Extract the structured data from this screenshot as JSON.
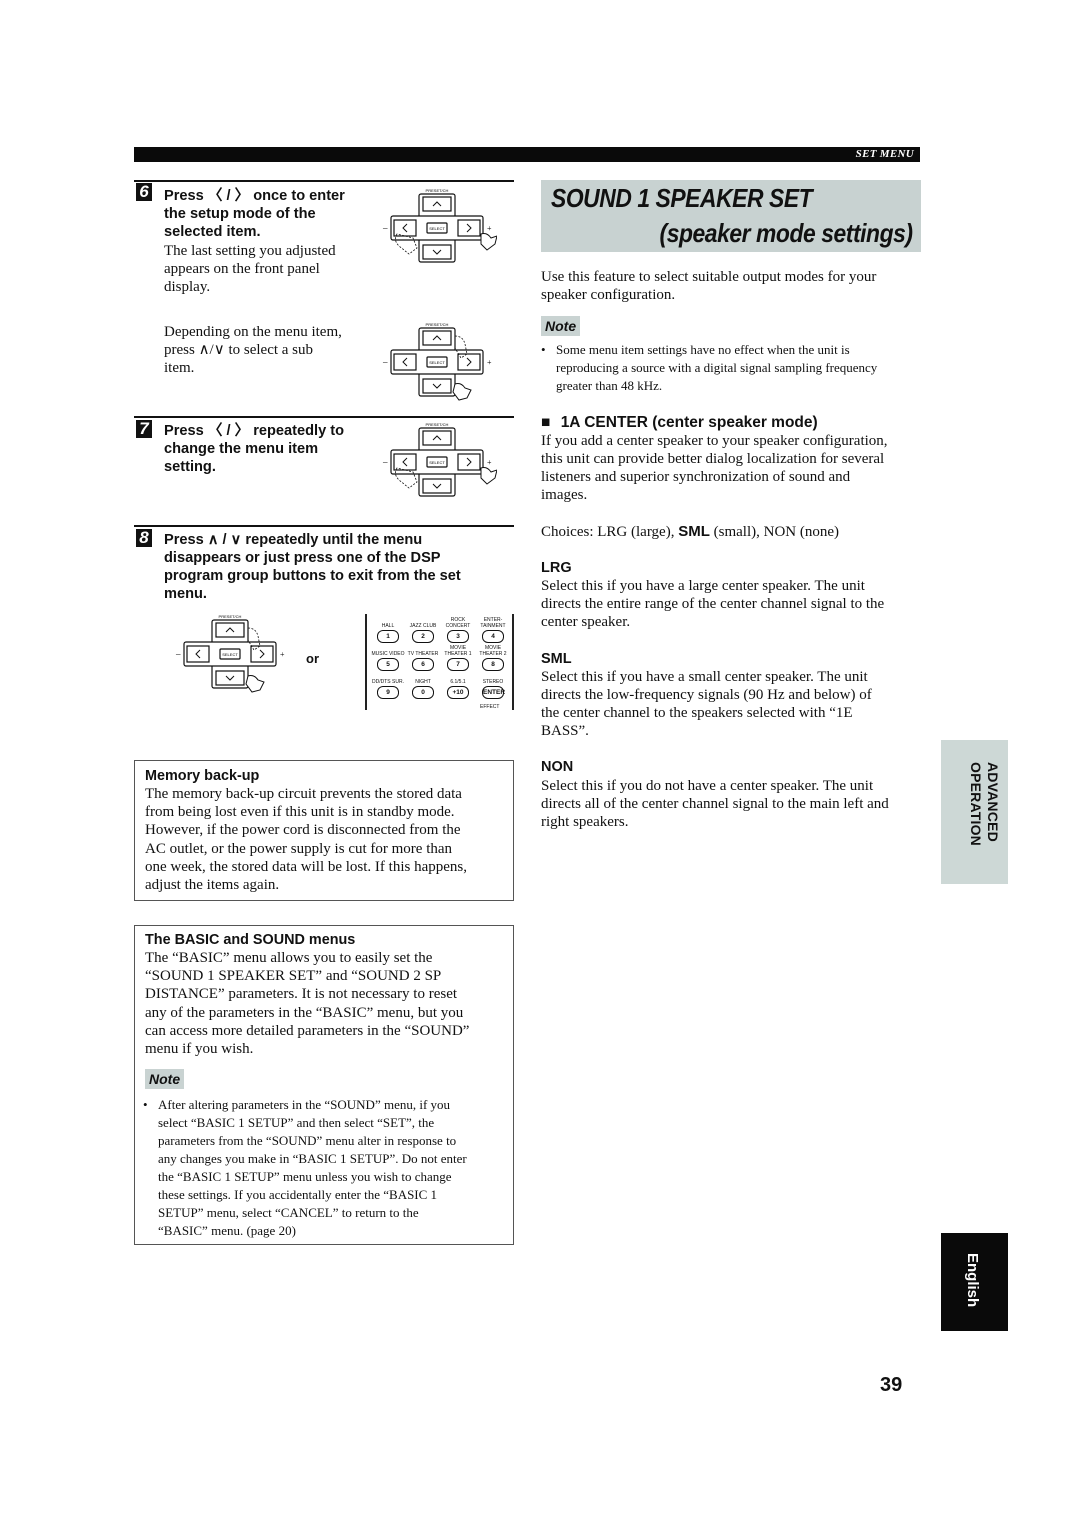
{
  "header": {
    "section_label": "SET MENU"
  },
  "steps": [
    {
      "number": "6",
      "heading": [
        "Press 〈 / 〉 once to enter",
        "the setup mode of the",
        "selected item."
      ],
      "body": [
        "The last setting you adjusted",
        "appears on the front panel",
        "display."
      ],
      "sub_body": [
        "Depending on the menu item,",
        "press ∧/∨ to select a sub",
        "item."
      ]
    },
    {
      "number": "7",
      "heading": [
        "Press 〈 / 〉 repeatedly to",
        "change the menu item",
        "setting."
      ]
    },
    {
      "number": "8",
      "heading": [
        "Press ∧ / ∨ repeatedly until the menu",
        "disappears or just press one of the DSP",
        "program group buttons to exit from the set",
        "menu."
      ]
    }
  ],
  "remote_pad": {
    "top_label": "PRESET/CH",
    "center_label": "SELECT",
    "minus": "–",
    "plus": "+",
    "up": "∧",
    "down": "∨",
    "left": "〈",
    "right": "〉"
  },
  "or_label": "or",
  "dsp_buttons": [
    {
      "label": "HALL",
      "key": "1"
    },
    {
      "label": "JAZZ CLUB",
      "key": "2"
    },
    {
      "label": "ROCK CONCERT",
      "key": "3"
    },
    {
      "label": "ENTER- TAINMENT",
      "key": "4"
    },
    {
      "label": "MUSIC VIDEO",
      "key": "5"
    },
    {
      "label": "TV THEATER",
      "key": "6"
    },
    {
      "label": "MOVIE THEATER 1",
      "key": "7"
    },
    {
      "label": "MOVIE THEATER 2",
      "key": "8"
    },
    {
      "label": "DD/DTS SUR.",
      "key": "9"
    },
    {
      "label": "NIGHT",
      "key": "0"
    },
    {
      "label": "6.1/5.1",
      "key": "+10"
    },
    {
      "label": "STEREO",
      "key": "ENTER"
    }
  ],
  "dsp_effect_label": "EFFECT",
  "memory_box": {
    "title": "Memory back-up",
    "body": [
      "The memory back-up circuit prevents the stored data",
      "from being lost even if this unit is in standby mode.",
      "However, if the power cord is disconnected from the",
      "AC outlet, or the power supply is cut for more than",
      "one week, the stored data will be lost. If this happens,",
      "adjust the items again."
    ]
  },
  "basic_box": {
    "title": "The BASIC and SOUND menus",
    "body": [
      "The “BASIC” menu allows you to easily set the",
      "“SOUND 1 SPEAKER SET” and “SOUND 2 SP",
      "DISTANCE” parameters. It is not necessary to reset",
      "any of the parameters in the “BASIC” menu, but you",
      "can access more detailed parameters in the “SOUND”",
      "menu if you wish."
    ],
    "note_label": "Note",
    "note_bullet": "•",
    "note": [
      "After altering parameters in the “SOUND” menu, if you",
      "select “BASIC 1 SETUP” and then select “SET”, the",
      "parameters from the “SOUND” menu alter in response to",
      "any changes you make in “BASIC 1 SETUP”. Do not enter",
      "the “BASIC 1 SETUP” menu unless you wish to change",
      "these settings. If you accidentally enter the “BASIC 1",
      "SETUP” menu, select “CANCEL” to return to the",
      "“BASIC” menu. (page 20)"
    ]
  },
  "right": {
    "title_line1": "SOUND 1  SPEAKER SET",
    "title_line2": "(speaker mode settings)",
    "intro": [
      "Use this feature to select suitable output modes for your",
      "speaker configuration."
    ],
    "note_label": "Note",
    "note_bullet": "•",
    "note": [
      "Some menu item settings have no effect when the unit is",
      "reproducing a source with a digital signal sampling frequency",
      "greater than 48 kHz."
    ],
    "section_marker": "■",
    "section_title": "1A CENTER (center speaker mode)",
    "section_body": [
      "If you add a center speaker to your speaker configuration,",
      "this unit can provide better dialog localization for several",
      "listeners and superior synchronization of sound and",
      "images."
    ],
    "choices_prefix": "Choices: LRG (large), ",
    "choices_default": "SML",
    "choices_suffix": " (small), NON (none)",
    "options": [
      {
        "name": "LRG",
        "body": [
          "Select this if you have a large center speaker. The unit",
          "directs the entire range of the center channel signal to the",
          "center speaker."
        ]
      },
      {
        "name": "SML",
        "body": [
          "Select this if you have a small center speaker. The unit",
          "directs the low-frequency signals (90 Hz and below) of",
          "the center channel to the speakers selected with “1E",
          "BASS”."
        ]
      },
      {
        "name": "NON",
        "body": [
          "Select this if you do not have a center speaker. The unit",
          "directs all of the center channel signal to the main left and",
          "right speakers."
        ]
      }
    ]
  },
  "side_tabs": {
    "advanced_line1": "ADVANCED",
    "advanced_line2": "OPERATION",
    "english": "English"
  },
  "page_number": "39"
}
